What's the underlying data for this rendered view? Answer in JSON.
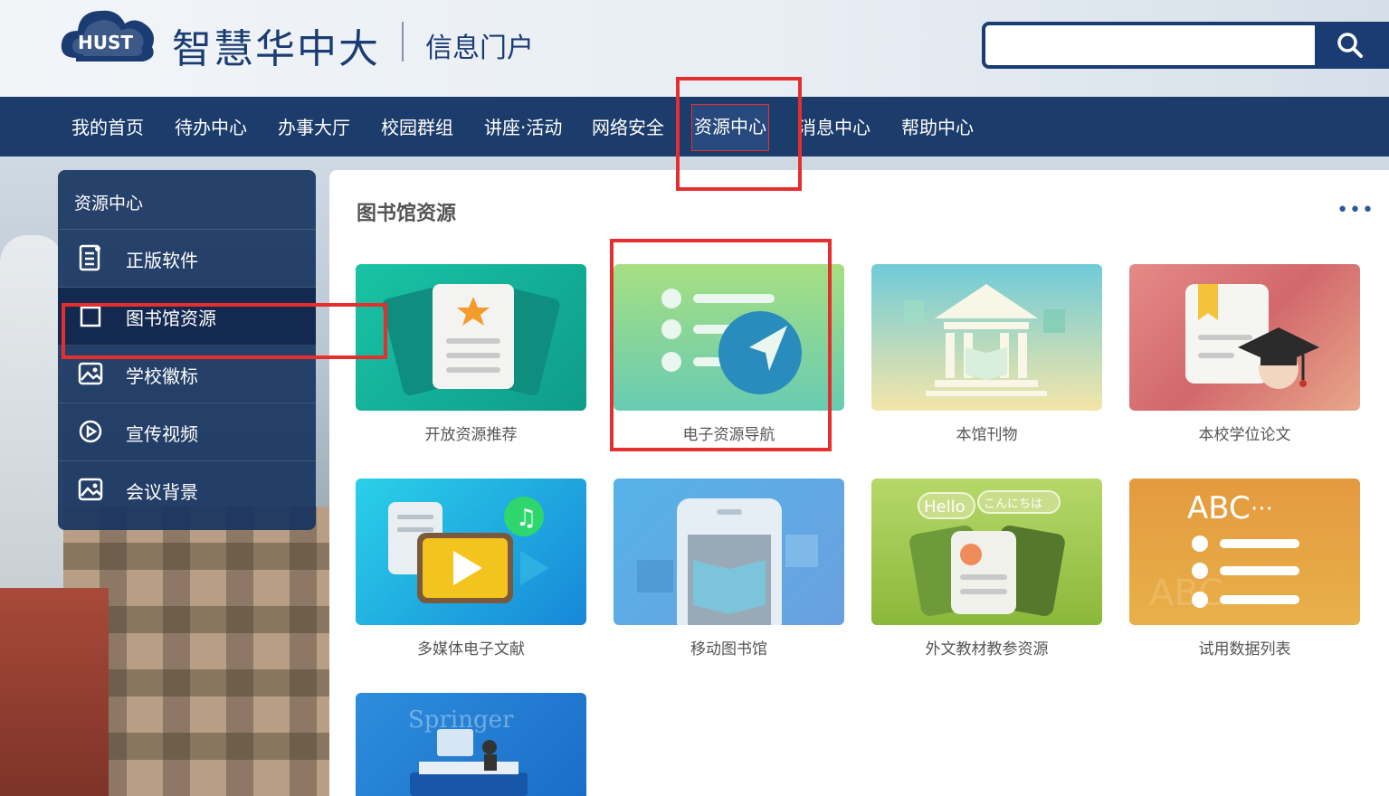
{
  "header": {
    "logo_text": "HUST",
    "title": "智慧华中大",
    "subtitle": "信息门户",
    "search": {
      "value": "",
      "placeholder": ""
    }
  },
  "nav": {
    "items": [
      {
        "label": "我的首页"
      },
      {
        "label": "待办中心"
      },
      {
        "label": "办事大厅"
      },
      {
        "label": "校园群组"
      },
      {
        "label": "讲座·活动"
      },
      {
        "label": "网络安全"
      },
      {
        "label": "资源中心"
      },
      {
        "label": "消息中心"
      },
      {
        "label": "帮助中心"
      }
    ],
    "active": "资源中心"
  },
  "sidebar": {
    "title": "资源中心",
    "items": [
      {
        "label": "正版软件",
        "icon": "document-list-icon"
      },
      {
        "label": "图书馆资源",
        "icon": "square-icon"
      },
      {
        "label": "学校徽标",
        "icon": "image-icon"
      },
      {
        "label": "宣传视频",
        "icon": "play-icon"
      },
      {
        "label": "会议背景",
        "icon": "image-icon"
      }
    ],
    "selected": "图书馆资源"
  },
  "main": {
    "title": "图书馆资源",
    "more": "•••",
    "cards": [
      {
        "label": "开放资源推荐",
        "color": "#16b39a"
      },
      {
        "label": "电子资源导航",
        "color": "#8ad38a"
      },
      {
        "label": "本馆刊物",
        "color": "#7fcad6"
      },
      {
        "label": "本校学位论文",
        "color": "#e07b7b"
      },
      {
        "label": "多媒体电子文献",
        "color": "#2aa7e2"
      },
      {
        "label": "移动图书馆",
        "color": "#5aa0e0"
      },
      {
        "label": "外文教材教参资源",
        "color": "#9cc43a"
      },
      {
        "label": "试用数据列表",
        "color": "#e8a53e"
      },
      {
        "label": "",
        "color": "#2a82d6",
        "watermark": "Springer"
      }
    ]
  },
  "thumb_text": {
    "hello": "Hello",
    "konnichiwa": "こんにちは",
    "abc": "ABC",
    "abc_dots": "···",
    "ghost_abc": "ABC"
  }
}
